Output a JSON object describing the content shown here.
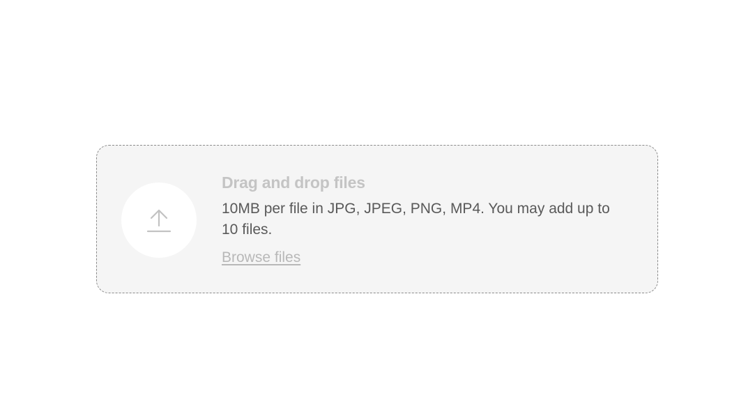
{
  "dropzone": {
    "title": "Drag and drop files",
    "description": "10MB per file in JPG, JPEG, PNG, MP4. You may add up to 10 files.",
    "browse_label": "Browse files",
    "icon": "upload-icon"
  },
  "colors": {
    "background": "#ffffff",
    "dropzone_fill": "#f5f5f5",
    "dropzone_border": "#8a8a8a",
    "title_text": "#c4c4c4",
    "description_text": "#595959",
    "link_text": "#b8b8b8",
    "icon_stroke": "#c2c2c2"
  }
}
